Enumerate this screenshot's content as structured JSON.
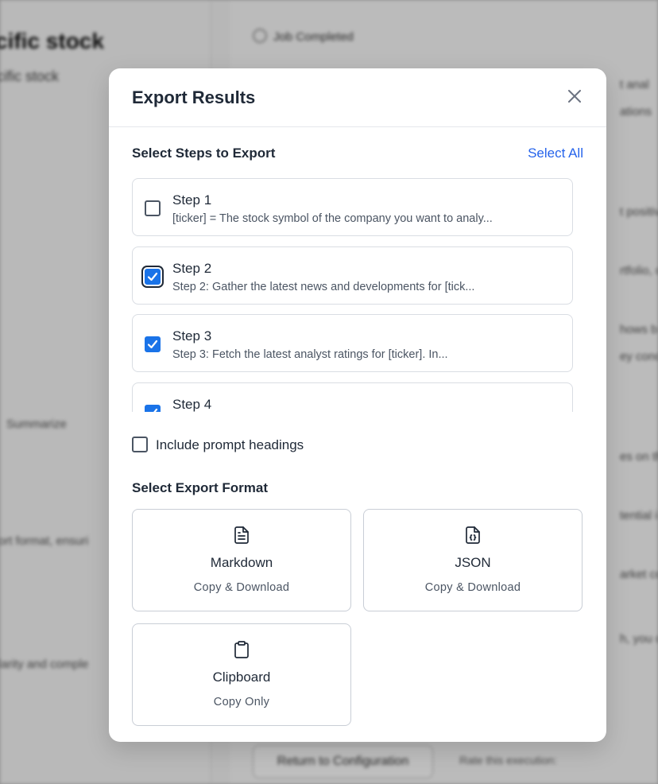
{
  "background": {
    "title": "cific stock",
    "subtitle": "cific stock",
    "status": "Job Completed",
    "texts": [
      "t",
      "Summarize",
      "ort format, ensuri",
      "larity and comple",
      "t anal",
      "ations",
      "t positive",
      "rtfolio, c",
      "hows b",
      "ey conce",
      "es on th",
      "tential i",
      "arket co",
      "h, you c"
    ],
    "return_button": "Return to Configuration",
    "footer": "Rate this execution:"
  },
  "modal": {
    "title": "Export Results",
    "steps_label": "Select Steps to Export",
    "select_all": "Select All",
    "steps": [
      {
        "title": "Step 1",
        "desc": "[ticker] = The stock symbol of the company you want to analy...",
        "checked": false
      },
      {
        "title": "Step 2",
        "desc": "Step 2: Gather the latest news and developments for [tick...",
        "checked": true
      },
      {
        "title": "Step 3",
        "desc": "Step 3: Fetch the latest analyst ratings for [ticker]. In...",
        "checked": true
      },
      {
        "title": "Step 4",
        "desc": "",
        "checked": true
      }
    ],
    "include_headings": "Include prompt headings",
    "include_headings_checked": false,
    "format_label": "Select Export Format",
    "formats": [
      {
        "name": "Markdown",
        "sub": "Copy & Download",
        "icon": "file-text-icon"
      },
      {
        "name": "JSON",
        "sub": "Copy & Download",
        "icon": "file-json-icon"
      },
      {
        "name": "Clipboard",
        "sub": "Copy Only",
        "icon": "clipboard-icon"
      }
    ]
  },
  "colors": {
    "accent": "#1a73e8",
    "link": "#2563eb",
    "text": "#1f2937",
    "muted": "#4b5563"
  }
}
